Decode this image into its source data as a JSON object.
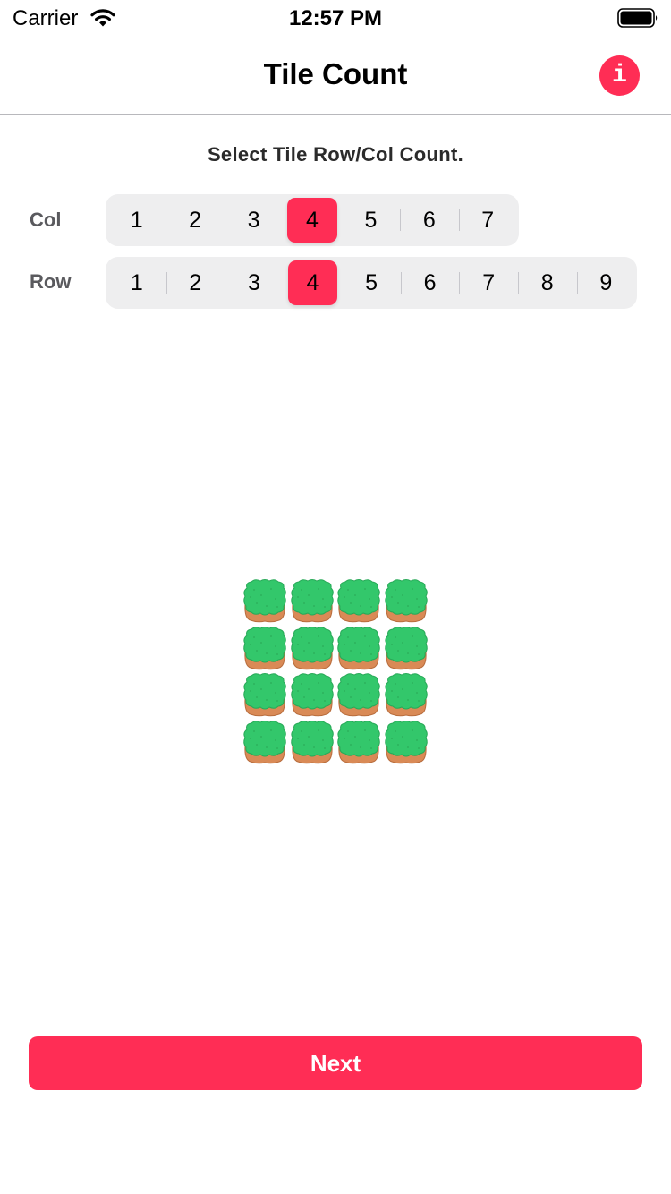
{
  "status_bar": {
    "carrier": "Carrier",
    "time": "12:57 PM"
  },
  "nav": {
    "title": "Tile Count",
    "info_icon": "i"
  },
  "instruction": "Select Tile Row/Col Count.",
  "col_selector": {
    "label": "Col",
    "options": [
      "1",
      "2",
      "3",
      "4",
      "5",
      "6",
      "7"
    ],
    "selected": "4"
  },
  "row_selector": {
    "label": "Row",
    "options": [
      "1",
      "2",
      "3",
      "4",
      "5",
      "6",
      "7",
      "8",
      "9"
    ],
    "selected": "4"
  },
  "tile_grid": {
    "columns": 4,
    "rows": 4,
    "tile_icon": "grass-dirt-tile-icon"
  },
  "next_button": {
    "label": "Next"
  },
  "colors": {
    "accent": "#ff2d55",
    "grass": "#33c76b",
    "dirt": "#d98a56"
  }
}
